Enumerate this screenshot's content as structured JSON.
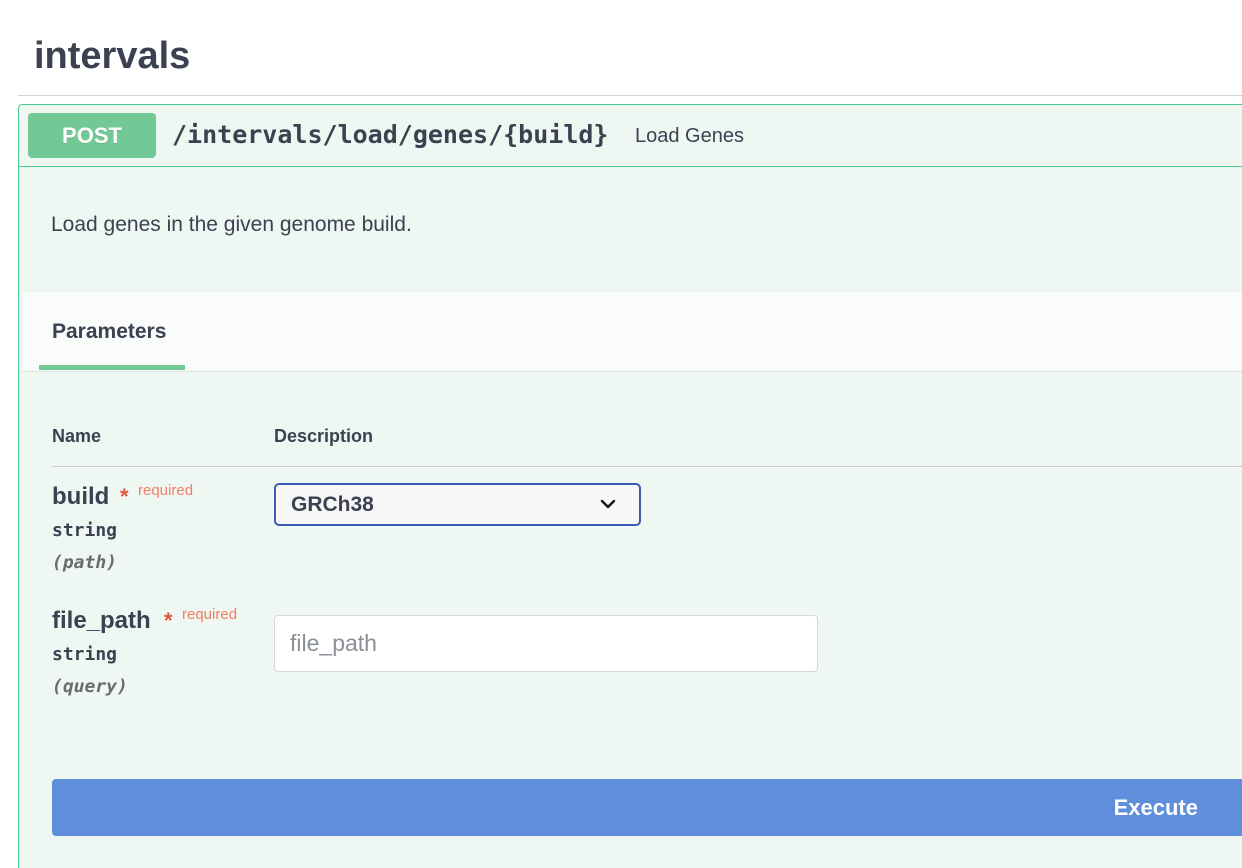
{
  "tag": {
    "title": "intervals"
  },
  "operation": {
    "method": "POST",
    "path": "/intervals/load/genes/{build}",
    "summary": "Load Genes",
    "description": "Load genes in the given genome build.",
    "method_color": "#73c995"
  },
  "tabs": {
    "parameters": "Parameters"
  },
  "table": {
    "name_header": "Name",
    "description_header": "Description"
  },
  "params": [
    {
      "name": "build",
      "required_mark": "*",
      "required_label": "required",
      "type": "string",
      "in": "(path)",
      "selected_value": "GRCh38"
    },
    {
      "name": "file_path",
      "required_mark": "*",
      "required_label": "required",
      "type": "string",
      "in": "(query)",
      "placeholder": "file_path"
    }
  ],
  "actions": {
    "execute_label": "Execute",
    "execute_color": "#5f8fdc"
  }
}
